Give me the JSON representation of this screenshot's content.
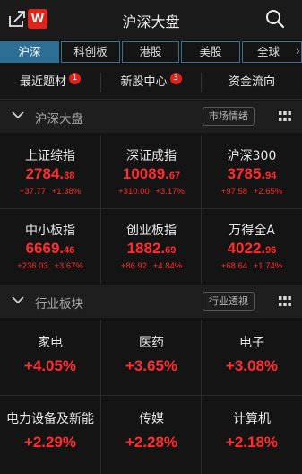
{
  "header": {
    "title": "沪深大盘",
    "logo_text": "W"
  },
  "tabs": [
    {
      "label": "沪深",
      "active": true
    },
    {
      "label": "科创板",
      "active": false
    },
    {
      "label": "港股",
      "active": false
    },
    {
      "label": "美股",
      "active": false
    },
    {
      "label": "全球",
      "active": false
    }
  ],
  "tabs_more_glyph": "›",
  "quick_links": [
    {
      "label": "最近题材",
      "badge": "1"
    },
    {
      "label": "新股中心",
      "badge": "3"
    },
    {
      "label": "资金流向",
      "badge": null
    }
  ],
  "market_section": {
    "title": "沪深大盘",
    "button": "市场情绪"
  },
  "indices": [
    {
      "name": "上证综指",
      "price_int": "2784.",
      "price_dec": "38",
      "change": "+37.77",
      "pct": "+1.38%"
    },
    {
      "name": "深证成指",
      "price_int": "10089.",
      "price_dec": "67",
      "change": "+310.00",
      "pct": "+3.17%"
    },
    {
      "name": "沪深300",
      "price_int": "3785.",
      "price_dec": "94",
      "change": "+97.58",
      "pct": "+2.65%"
    },
    {
      "name": "中小板指",
      "price_int": "6669.",
      "price_dec": "46",
      "change": "+236.03",
      "pct": "+3.67%"
    },
    {
      "name": "创业板指",
      "price_int": "1882.",
      "price_dec": "69",
      "change": "+86.92",
      "pct": "+4.84%"
    },
    {
      "name": "万得全A",
      "price_int": "4022.",
      "price_dec": "96",
      "change": "+68.64",
      "pct": "+1.74%"
    }
  ],
  "industry_section": {
    "title": "行业板块",
    "button": "行业透视"
  },
  "industries": [
    {
      "name": "家电",
      "pct": "+4.05%"
    },
    {
      "name": "医药",
      "pct": "+3.65%"
    },
    {
      "name": "电子",
      "pct": "+3.08%"
    },
    {
      "name": "电力设备及新能",
      "pct": "+2.29%"
    },
    {
      "name": "传媒",
      "pct": "+2.28%"
    },
    {
      "name": "计算机",
      "pct": "+2.18%"
    }
  ],
  "colors": {
    "up": "#ff2d2d",
    "accent": "#2d6e95",
    "badge": "#e2231a"
  }
}
